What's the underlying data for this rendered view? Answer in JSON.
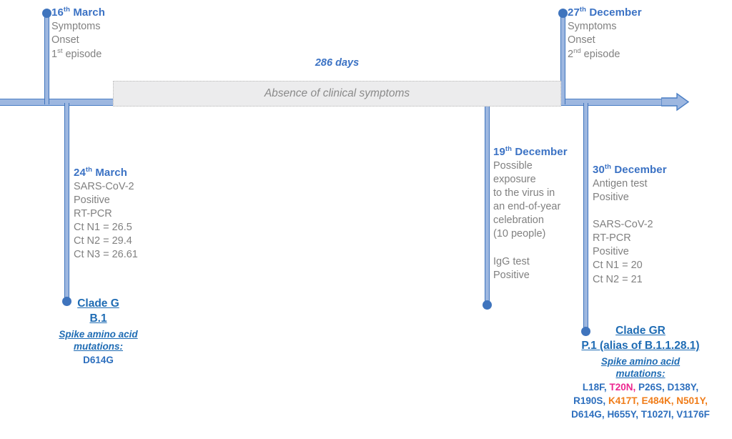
{
  "timeline": {
    "duration_label": "286 days",
    "absence_label": "Absence of clinical symptoms",
    "axis_color": "#9db7e0",
    "line_color": "#3f74bd",
    "date_color": "#3b72c4",
    "detail_color": "#818181"
  },
  "events": {
    "symptoms_onset_1": {
      "date": "16",
      "date_suffix": "th",
      "month": " March",
      "lines": [
        "Symptoms",
        "Onset",
        "1st episode"
      ],
      "episode_number": "1",
      "episode_suffix": "st",
      "episode_rest": " episode"
    },
    "symptoms_onset_2": {
      "date": "27",
      "date_suffix": "th",
      "month": " December",
      "lines": [
        "Symptoms",
        "Onset",
        "2nd episode"
      ],
      "episode_number": "2",
      "episode_suffix": "nd",
      "episode_rest": " episode"
    },
    "first_pcr": {
      "date": "24",
      "date_suffix": "th",
      "month": " March",
      "lines": [
        "SARS-CoV-2",
        "Positive",
        "RT-PCR",
        "Ct N1 = 26.5",
        "Ct N2 = 29.4",
        "Ct N3 = 26.61"
      ]
    },
    "exposure": {
      "date": "19",
      "date_suffix": "th",
      "month": " December",
      "lines": [
        "Possible",
        "exposure",
        "to the virus in",
        "an end-of-year",
        "celebration",
        "(10 people)",
        "",
        "IgG test",
        "Positive"
      ]
    },
    "second_pcr": {
      "date": "30",
      "date_suffix": "th",
      "month": " December",
      "lines": [
        "Antigen test",
        "Positive",
        "",
        "SARS-CoV-2",
        "RT-PCR",
        "Positive",
        "Ct N1 = 20",
        "Ct N2 = 21"
      ]
    }
  },
  "clades": {
    "first": {
      "clade_name": "Clade G",
      "lineage": "B.1",
      "mutations_header_line1": "Spike amino acid",
      "mutations_header_line2": "mutations:",
      "mutations": [
        {
          "text": "D614G",
          "color": "#2d6fbe"
        }
      ]
    },
    "second": {
      "clade_name": "Clade GR",
      "lineage": "P.1 (alias of B.1.1.28.1)",
      "mutations_header_line1": "Spike amino acid",
      "mutations_header_line2": "mutations:",
      "mutation_rows": [
        [
          {
            "text": "L18F,",
            "color": "#2d6fbe"
          },
          {
            "text": "T20N,",
            "color": "#ec268f"
          },
          {
            "text": "P26S,",
            "color": "#2d6fbe"
          },
          {
            "text": "D138Y,",
            "color": "#2d6fbe"
          }
        ],
        [
          {
            "text": "R190S,",
            "color": "#2d6fbe"
          },
          {
            "text": "K417T,",
            "color": "#f07d1a"
          },
          {
            "text": "E484K,",
            "color": "#f07d1a"
          },
          {
            "text": "N501Y,",
            "color": "#f07d1a"
          }
        ],
        [
          {
            "text": "D614G,",
            "color": "#2d6fbe"
          },
          {
            "text": "H655Y,",
            "color": "#2d6fbe"
          },
          {
            "text": "T1027I,",
            "color": "#2d6fbe"
          },
          {
            "text": "V1176F",
            "color": "#2d6fbe"
          }
        ]
      ]
    }
  }
}
